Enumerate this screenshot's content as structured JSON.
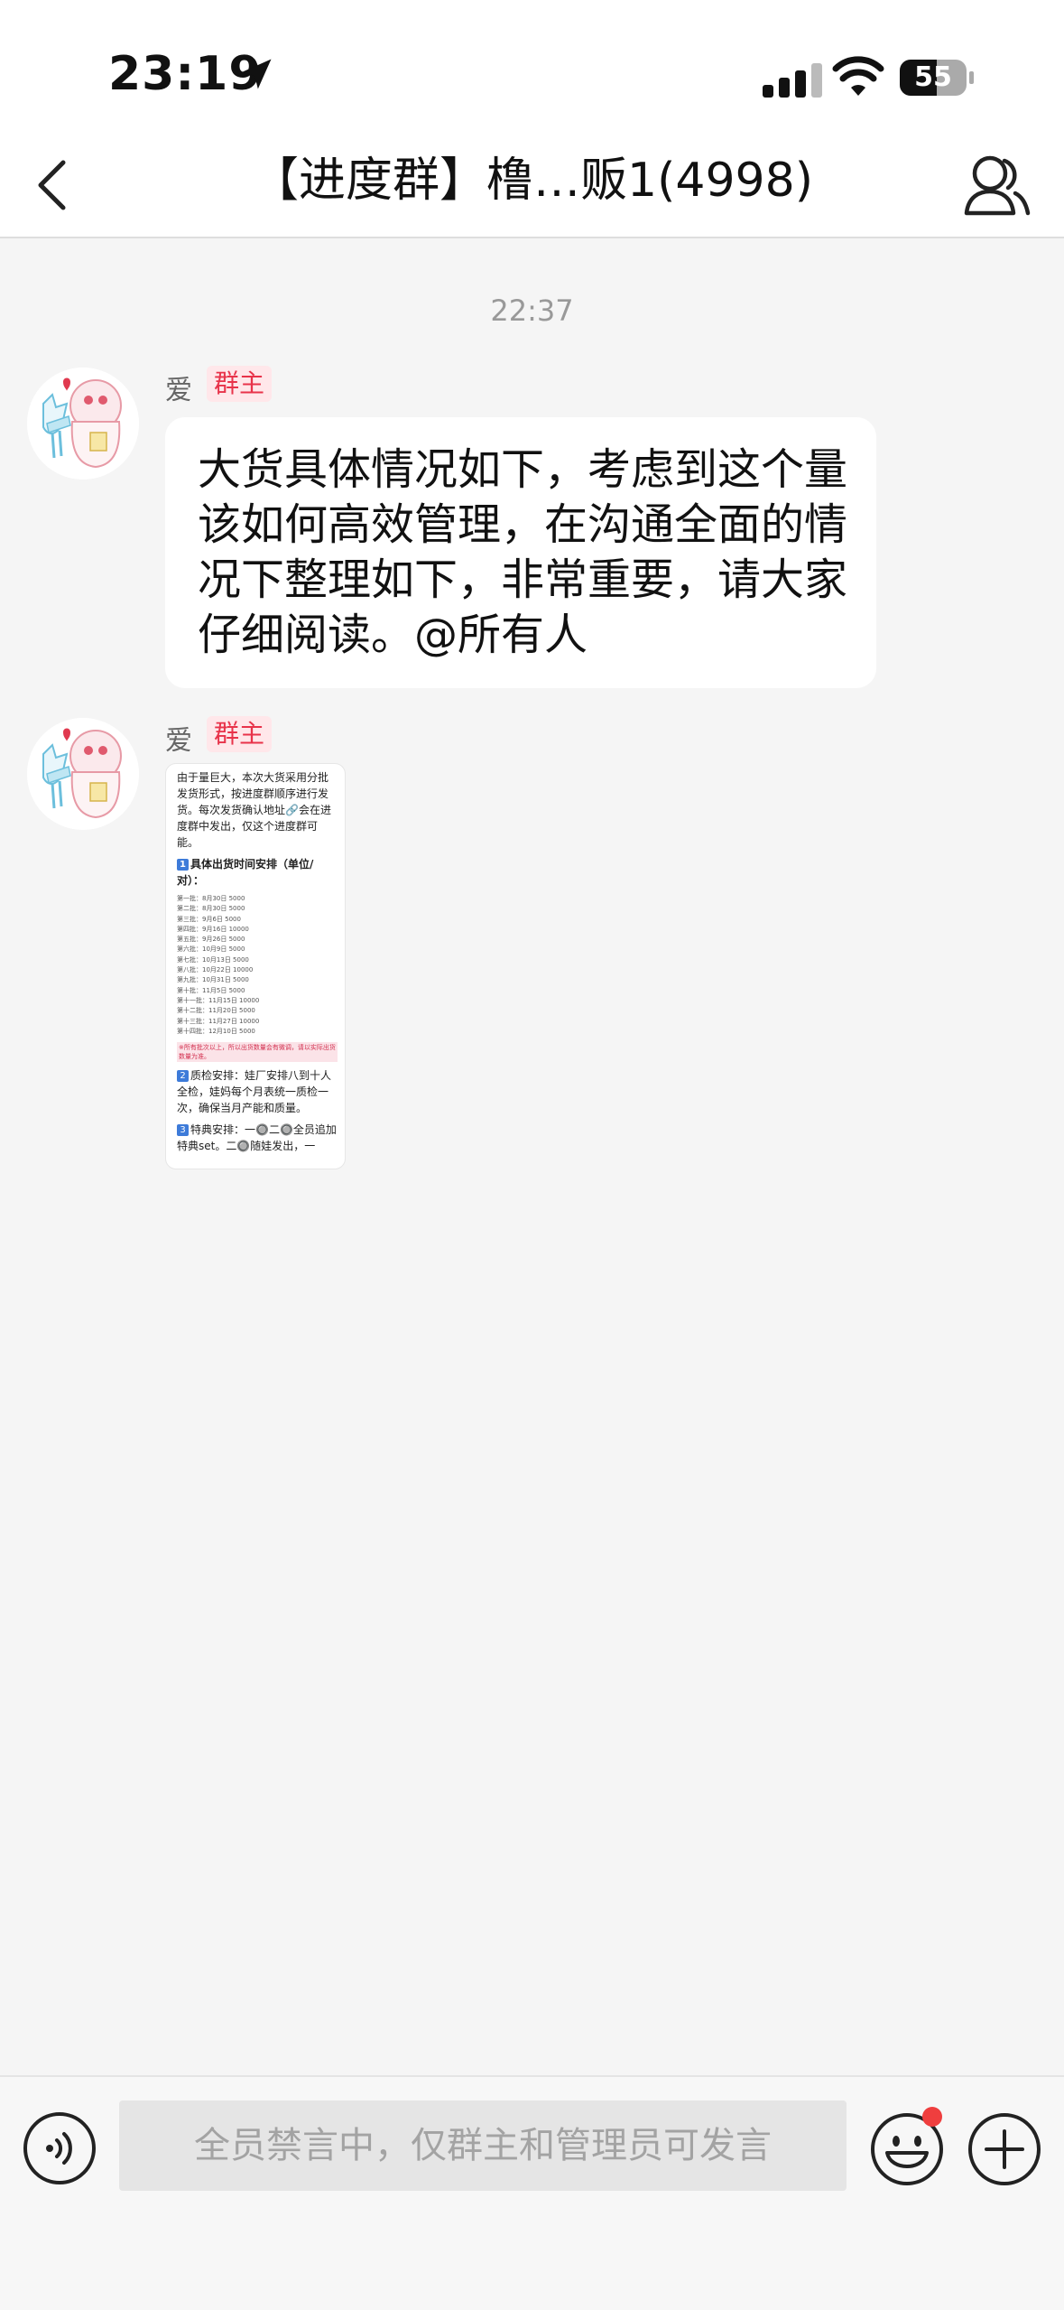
{
  "status_bar": {
    "time": "23:19",
    "battery_level": "55",
    "icons": [
      "location-arrow-icon",
      "cellular-signal-icon",
      "wifi-icon",
      "battery-icon"
    ]
  },
  "header": {
    "title": "【进度群】橹…贩1(4998)",
    "back_icon": "chevron-left-icon",
    "members_icon": "group-members-icon"
  },
  "chat": {
    "timestamp": "22:37",
    "messages": [
      {
        "sender": "爱",
        "role": "群主",
        "text": "大货具体情况如下，考虑到这个量该如何高效管理，在沟通全面的情况下整理如下，非常重要，请大家仔细阅读。@所有人"
      },
      {
        "sender": "爱",
        "role": "群主",
        "image": {
          "intro": "由于量巨大，本次大货采用分批发货形式，按进度群顺序进行发货。每次发货确认地址🔗会在进度群中发出，仅这个进度群可能。",
          "section1_title": "具体出货时间安排（单位/对）：",
          "schedule": [
            "第一批：8月30日 5000",
            "第二批：8月30日 5000",
            "第三批：9月6日 5000",
            "第四批：9月16日 10000",
            "第五批：9月26日 5000",
            "第六批：10月9日 5000",
            "第七批：10月13日 5000",
            "第八批：10月22日 10000",
            "第九批：10月31日 5000",
            "第十批：11月5日 5000",
            "第十一批：11月15日 10000",
            "第十二批：11月20日 5000",
            "第十三批：11月27日 10000",
            "第十四批：12月10日 5000"
          ],
          "note": "※所有批次以上，所以出货数量会有微调，请以实际出货数量为准。",
          "section2": "质检安排：娃厂安排八到十人全检，娃妈每个月表统一质检一次，确保当月产能和质量。",
          "section3": "特典安排：一🔘二🔘全员追加特典set。二🔘随娃发出，一"
        }
      }
    ]
  },
  "input_bar": {
    "placeholder": "全员禁言中，仅群主和管理员可发言",
    "voice_icon": "voice-input-icon",
    "emoji_icon": "emoji-icon",
    "plus_icon": "plus-icon"
  },
  "colors": {
    "role_badge_text": "#e8334a",
    "role_badge_bg": "#ffe7ea",
    "background": "#f5f5f5",
    "notification_dot": "#ef3e3e"
  }
}
